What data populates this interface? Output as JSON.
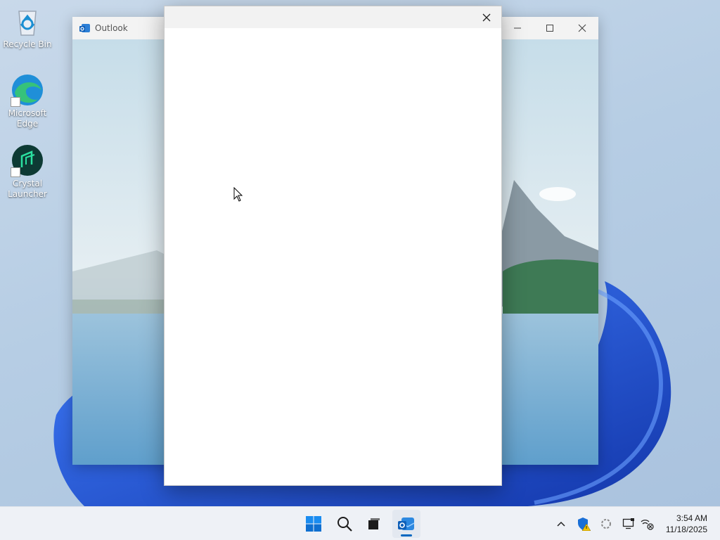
{
  "desktop": {
    "icons": [
      {
        "label": "Recycle Bin",
        "icon": "recycle-bin-icon"
      },
      {
        "label": "Microsoft Edge",
        "icon": "edge-icon"
      },
      {
        "label": "Crystal Launcher",
        "icon": "crystal-launcher-icon"
      }
    ]
  },
  "outlook_window": {
    "title": "Outlook",
    "controls": {
      "minimize": "minimize-icon",
      "maximize": "maximize-icon",
      "close": "close-icon"
    }
  },
  "dialog": {
    "close_icon": "close-icon"
  },
  "taskbar": {
    "items": [
      "start-icon",
      "search-icon",
      "task-view-icon",
      "outlook-icon"
    ],
    "active_item": "outlook-icon",
    "tray": [
      "chevron-up-icon",
      "security-warning-icon",
      "sync-icon",
      "display-icon",
      "network-disconnected-icon"
    ],
    "time": "3:54 AM",
    "date": "11/18/2025"
  },
  "colors": {
    "accent": "#0067c0",
    "bloom": "#1a4fd6"
  }
}
